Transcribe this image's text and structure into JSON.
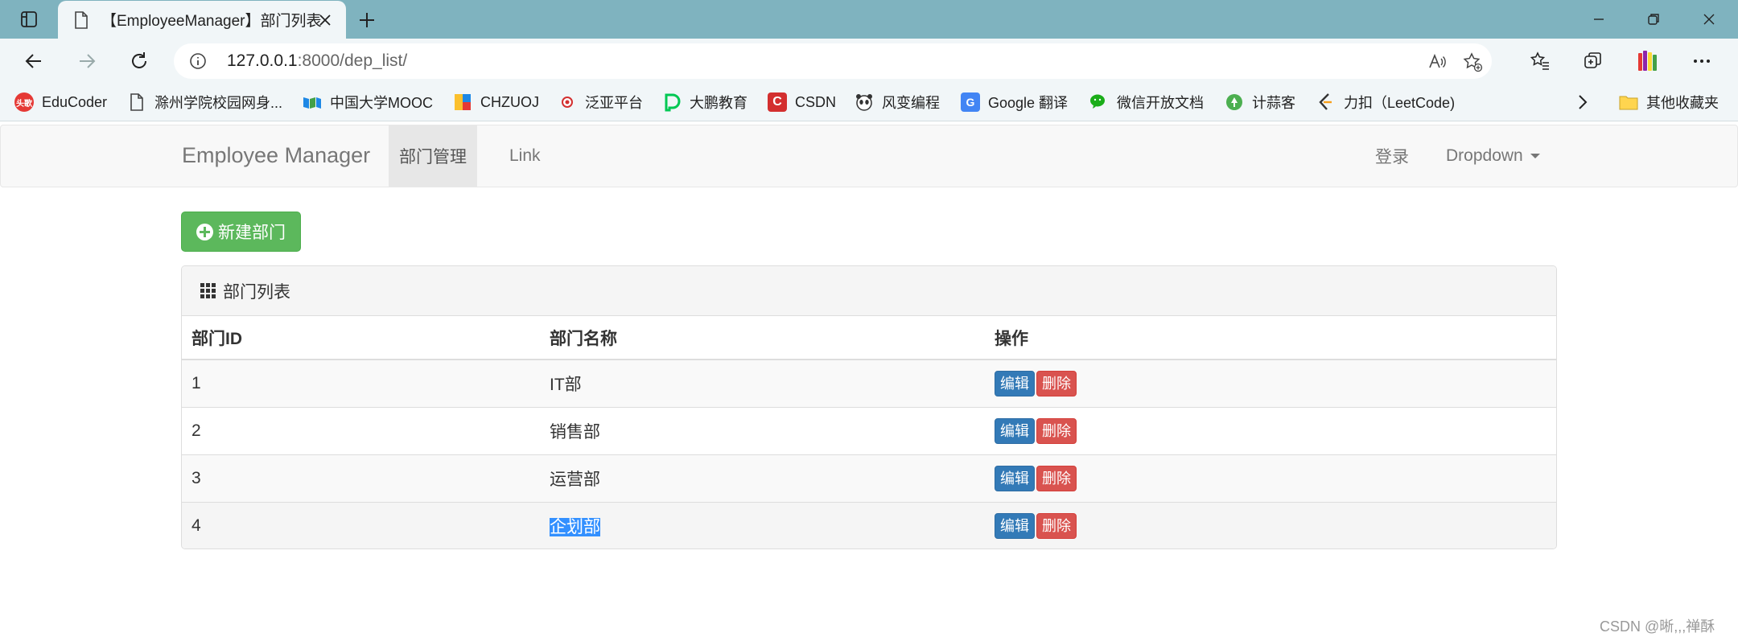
{
  "browser": {
    "tab_title": "【EmployeeManager】部门列表",
    "url_host": "127.0.0.1",
    "url_rest": ":8000/dep_list/",
    "bookmarks": [
      {
        "label": "EduCoder",
        "icon": "educoder-logo",
        "color": "#e53935",
        "glyph": "头歌"
      },
      {
        "label": "滁州学院校园网身...",
        "icon": "page-icon",
        "color": "",
        "glyph": ""
      },
      {
        "label": "中国大学MOOC",
        "icon": "mooc-logo",
        "color": "#2196f3",
        "glyph": ""
      },
      {
        "label": "CHZUOJ",
        "icon": "chzuoj-logo",
        "color": "#ffb300",
        "glyph": ""
      },
      {
        "label": "泛亚平台",
        "icon": "fanya-logo",
        "color": "#d32f2f",
        "glyph": ""
      },
      {
        "label": "大鹏教育",
        "icon": "dapeng-logo",
        "color": "#00c853",
        "glyph": ""
      },
      {
        "label": "CSDN",
        "icon": "csdn-logo",
        "color": "#d32f2f",
        "glyph": "C"
      },
      {
        "label": "风变编程",
        "icon": "fengbian-logo",
        "color": "#444",
        "glyph": ""
      },
      {
        "label": "Google 翻译",
        "icon": "google-translate-logo",
        "color": "#4285f4",
        "glyph": "G"
      },
      {
        "label": "微信开放文档",
        "icon": "wechat-logo",
        "color": "#1aad19",
        "glyph": ""
      },
      {
        "label": "计蒜客",
        "icon": "jisuanke-logo",
        "color": "#4caf50",
        "glyph": ""
      },
      {
        "label": "力扣（LeetCode)",
        "icon": "leetcode-logo",
        "color": "#333",
        "glyph": ""
      }
    ],
    "other_bookmarks": "其他收藏夹"
  },
  "navbar": {
    "brand": "Employee Manager",
    "items": [
      "部门管理",
      "Link"
    ],
    "login": "登录",
    "dropdown": "Dropdown"
  },
  "actions": {
    "new_button": "新建部门"
  },
  "panel": {
    "title": "部门列表",
    "columns": [
      "部门ID",
      "部门名称",
      "操作"
    ],
    "rows": [
      {
        "id": "1",
        "name": "IT部"
      },
      {
        "id": "2",
        "name": "销售部"
      },
      {
        "id": "3",
        "name": "运营部"
      },
      {
        "id": "4",
        "name": "企划部"
      }
    ],
    "edit_label": "编辑",
    "delete_label": "删除"
  },
  "watermark": "CSDN @晰,,,禅酥",
  "colors": {
    "success": "#5cb85c",
    "primary": "#337ab7",
    "danger": "#d9534f",
    "tabstrip": "#7fb3bf"
  }
}
